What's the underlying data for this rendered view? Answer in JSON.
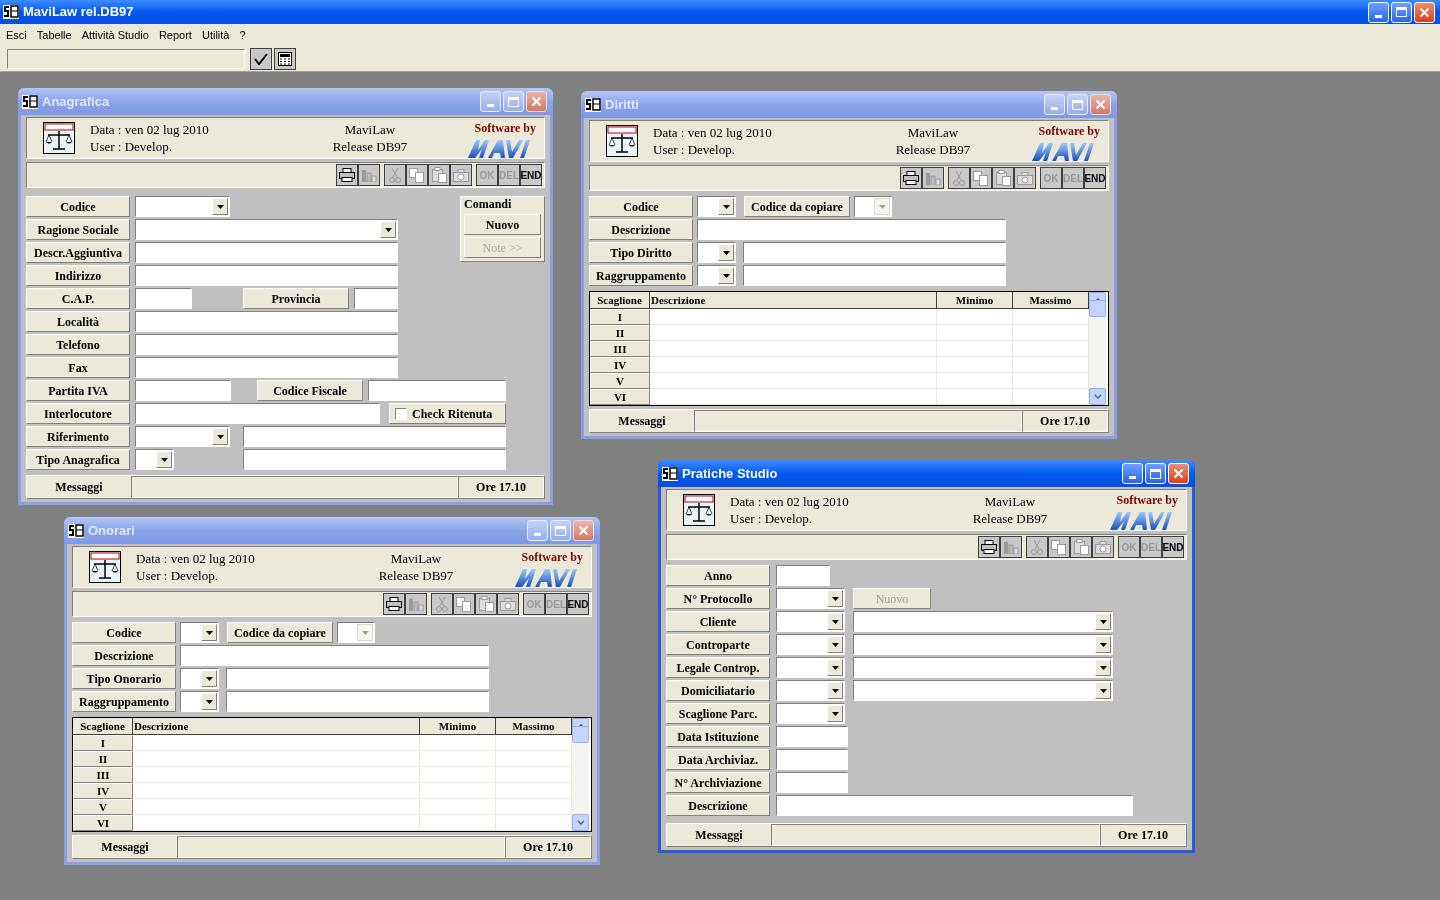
{
  "app": {
    "title": "MaviLaw rel.DB97",
    "menu": [
      "Esci",
      "Tabelle",
      "Attività Studio",
      "Report",
      "Utilità",
      "?"
    ]
  },
  "windows": [
    {
      "kind": "anagrafica",
      "title": "Anagrafica",
      "active": false,
      "header": {
        "date": "Data : ven 02 lug 2010",
        "user": "User : Develop.",
        "app": "MaviLaw",
        "release": "Release DB97",
        "credit": "Software by"
      },
      "toolbar": [
        {
          "kind": "print",
          "disabled": false
        },
        {
          "kind": "chart",
          "disabled": true
        },
        {
          "kind": "cut",
          "disabled": true
        },
        {
          "kind": "copy",
          "disabled": true
        },
        {
          "kind": "paste",
          "disabled": true
        },
        {
          "kind": "camera",
          "disabled": true
        },
        {
          "kind": "text",
          "label": "OK",
          "disabled": true
        },
        {
          "kind": "text",
          "label": "DEL",
          "disabled": true
        },
        {
          "kind": "text",
          "label": "END",
          "disabled": false
        }
      ],
      "form": [
        {
          "label": "Codice",
          "controls": [
            {
              "kind": "combo",
              "disabled": false
            }
          ]
        },
        {
          "label": "Ragione Sociale",
          "controls": [
            {
              "kind": "combo",
              "disabled": false
            }
          ]
        },
        {
          "label": "Descr.Aggiuntiva",
          "controls": [
            {
              "kind": "text"
            }
          ]
        },
        {
          "label": "Indirizzo",
          "controls": [
            {
              "kind": "text"
            }
          ]
        },
        {
          "label": "C.A.P.",
          "controls": [
            {
              "kind": "text"
            },
            {
              "kind": "label",
              "label": "Provincia"
            },
            {
              "kind": "text"
            }
          ]
        },
        {
          "label": "Località",
          "controls": [
            {
              "kind": "text"
            }
          ]
        },
        {
          "label": "Telefono",
          "controls": [
            {
              "kind": "text"
            }
          ]
        },
        {
          "label": "Fax",
          "controls": [
            {
              "kind": "text"
            }
          ]
        },
        {
          "label": "Partita IVA",
          "controls": [
            {
              "kind": "text"
            },
            {
              "kind": "label",
              "label": "Codice Fiscale"
            },
            {
              "kind": "text"
            }
          ]
        },
        {
          "label": "Interlocutore",
          "controls": [
            {
              "kind": "text"
            },
            {
              "kind": "checkbox",
              "label": "Check Ritenuta",
              "checked": false
            }
          ]
        },
        {
          "label": "Riferimento",
          "controls": [
            {
              "kind": "combo",
              "disabled": false
            },
            {
              "kind": "text"
            }
          ]
        },
        {
          "label": "Tipo Anagrafica",
          "controls": [
            {
              "kind": "combo",
              "disabled": false
            },
            {
              "kind": "text"
            }
          ]
        }
      ],
      "commands": {
        "title": "Comandi",
        "buttons": [
          {
            "label": "Nuovo",
            "disabled": false
          },
          {
            "label": "Note >>",
            "disabled": true
          }
        ]
      },
      "status": {
        "label": "Messaggi",
        "time": "Ore 17.10"
      }
    },
    {
      "kind": "tariffe",
      "title": "Diritti",
      "active": false,
      "header": {
        "date": "Data : ven 02 lug 2010",
        "user": "User : Develop.",
        "app": "MaviLaw",
        "release": "Release DB97",
        "credit": "Software by"
      },
      "toolbar": [
        {
          "kind": "print",
          "disabled": false
        },
        {
          "kind": "chart",
          "disabled": true
        },
        {
          "kind": "cut",
          "disabled": true
        },
        {
          "kind": "copy",
          "disabled": true
        },
        {
          "kind": "paste",
          "disabled": true
        },
        {
          "kind": "camera",
          "disabled": true
        },
        {
          "kind": "text",
          "label": "OK",
          "disabled": true
        },
        {
          "kind": "text",
          "label": "DEL",
          "disabled": true
        },
        {
          "kind": "text",
          "label": "END",
          "disabled": false
        }
      ],
      "form": [
        {
          "label": "Codice",
          "controls": [
            {
              "kind": "combo",
              "disabled": false
            },
            {
              "kind": "label",
              "label": "Codice da copiare"
            },
            {
              "kind": "combo",
              "disabled": true
            }
          ]
        },
        {
          "label": "Descrizione",
          "controls": [
            {
              "kind": "text"
            }
          ]
        },
        {
          "label": "Tipo Diritto",
          "controls": [
            {
              "kind": "combo",
              "disabled": false
            },
            {
              "kind": "text"
            }
          ]
        },
        {
          "label": "Raggruppamento",
          "controls": [
            {
              "kind": "combo",
              "disabled": false
            },
            {
              "kind": "text"
            }
          ]
        }
      ],
      "table": {
        "columns": [
          "Scaglione",
          "Descrizione",
          "Minimo",
          "Massimo"
        ],
        "rows": [
          "I",
          "II",
          "III",
          "IV",
          "V",
          "VI"
        ]
      },
      "status": {
        "label": "Messaggi",
        "time": "Ore 17.10"
      }
    },
    {
      "kind": "pratiche",
      "title": "Pratiche Studio",
      "active": true,
      "header": {
        "date": "Data : ven 02 lug 2010",
        "user": "User : Develop.",
        "app": "MaviLaw",
        "release": "Release DB97",
        "credit": "Software by"
      },
      "toolbar": [
        {
          "kind": "print",
          "disabled": false
        },
        {
          "kind": "chart",
          "disabled": true
        },
        {
          "kind": "cut",
          "disabled": true
        },
        {
          "kind": "copy",
          "disabled": true
        },
        {
          "kind": "paste",
          "disabled": true
        },
        {
          "kind": "camera",
          "disabled": true
        },
        {
          "kind": "text",
          "label": "OK",
          "disabled": true
        },
        {
          "kind": "text",
          "label": "DEL",
          "disabled": true
        },
        {
          "kind": "text",
          "label": "END",
          "disabled": false
        }
      ],
      "form": [
        {
          "label": "Anno",
          "controls": [
            {
              "kind": "text"
            }
          ]
        },
        {
          "label": "N° Protocollo",
          "controls": [
            {
              "kind": "combo",
              "disabled": false
            },
            {
              "kind": "button",
              "label": "Nuovo",
              "disabled": true
            }
          ]
        },
        {
          "label": "Cliente",
          "controls": [
            {
              "kind": "combo",
              "disabled": false
            },
            {
              "kind": "combo",
              "disabled": false
            }
          ]
        },
        {
          "label": "Controparte",
          "controls": [
            {
              "kind": "combo",
              "disabled": false
            },
            {
              "kind": "combo",
              "disabled": false
            }
          ]
        },
        {
          "label": "Legale Controp.",
          "controls": [
            {
              "kind": "combo",
              "disabled": false
            },
            {
              "kind": "combo",
              "disabled": false
            }
          ]
        },
        {
          "label": "Domiciliatario",
          "controls": [
            {
              "kind": "combo",
              "disabled": false
            },
            {
              "kind": "combo",
              "disabled": false
            }
          ]
        },
        {
          "label": "Scaglione Parc.",
          "controls": [
            {
              "kind": "combo",
              "disabled": false
            }
          ]
        },
        {
          "label": "Data Istituzione",
          "controls": [
            {
              "kind": "text"
            }
          ]
        },
        {
          "label": "Data Archiviaz.",
          "controls": [
            {
              "kind": "text"
            }
          ]
        },
        {
          "label": "N° Archiviazione",
          "controls": [
            {
              "kind": "text"
            }
          ]
        },
        {
          "label": "Descrizione",
          "controls": [
            {
              "kind": "text"
            }
          ]
        }
      ],
      "status": {
        "label": "Messaggi",
        "time": "Ore 17.10"
      }
    },
    {
      "kind": "tariffe",
      "title": "Onorari",
      "active": false,
      "header": {
        "date": "Data : ven 02 lug 2010",
        "user": "User : Develop.",
        "app": "MaviLaw",
        "release": "Release DB97",
        "credit": "Software by"
      },
      "toolbar": [
        {
          "kind": "print",
          "disabled": false
        },
        {
          "kind": "chart",
          "disabled": true
        },
        {
          "kind": "cut",
          "disabled": true
        },
        {
          "kind": "copy",
          "disabled": true
        },
        {
          "kind": "paste",
          "disabled": true
        },
        {
          "kind": "camera",
          "disabled": true
        },
        {
          "kind": "text",
          "label": "OK",
          "disabled": true
        },
        {
          "kind": "text",
          "label": "DEL",
          "disabled": true
        },
        {
          "kind": "text",
          "label": "END",
          "disabled": false
        }
      ],
      "form": [
        {
          "label": "Codice",
          "controls": [
            {
              "kind": "combo",
              "disabled": false
            },
            {
              "kind": "label",
              "label": "Codice da copiare"
            },
            {
              "kind": "combo",
              "disabled": true
            }
          ]
        },
        {
          "label": "Descrizione",
          "controls": [
            {
              "kind": "text"
            }
          ]
        },
        {
          "label": "Tipo Onorario",
          "controls": [
            {
              "kind": "combo",
              "disabled": false
            },
            {
              "kind": "text"
            }
          ]
        },
        {
          "label": "Raggruppamento",
          "controls": [
            {
              "kind": "combo",
              "disabled": false
            },
            {
              "kind": "text"
            }
          ]
        }
      ],
      "table": {
        "columns": [
          "Scaglione",
          "Descrizione",
          "Minimo",
          "Massimo"
        ],
        "rows": [
          "I",
          "II",
          "III",
          "IV",
          "V",
          "VI"
        ]
      },
      "status": {
        "label": "Messaggi",
        "time": "Ore 17.10"
      }
    }
  ]
}
